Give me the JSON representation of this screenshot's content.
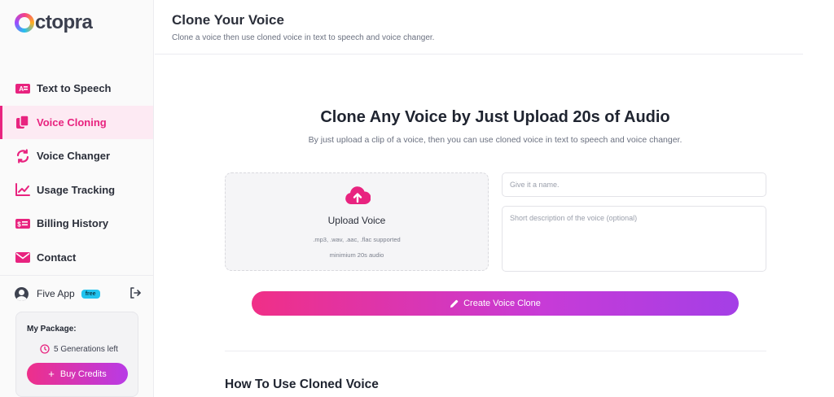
{
  "app": {
    "logo_text": "ctopra"
  },
  "sidebar": {
    "items": [
      {
        "label": "Text to Speech",
        "icon": "text-to-speech-icon",
        "active": false
      },
      {
        "label": "Voice Cloning",
        "icon": "copy-icon",
        "active": true
      },
      {
        "label": "Voice Changer",
        "icon": "refresh-icon",
        "active": false
      },
      {
        "label": "Usage Tracking",
        "icon": "chart-line-icon",
        "active": false
      },
      {
        "label": "Billing History",
        "icon": "billing-icon",
        "active": false
      },
      {
        "label": "Contact",
        "icon": "envelope-icon",
        "active": false
      }
    ],
    "user": {
      "name": "Five App",
      "plan_badge": "free"
    },
    "package": {
      "title": "My Package:",
      "generations_left": "5 Generations left",
      "buy_label": "Buy Credits"
    }
  },
  "header": {
    "title": "Clone Your Voice",
    "subtitle": "Clone a voice then use cloned voice in text to speech and voice changer."
  },
  "main": {
    "hero_title": "Clone Any Voice by Just Upload 20s of Audio",
    "hero_subtitle": "By just upload a clip of a voice, then you can use cloned voice in text to speech and voice changer.",
    "upload": {
      "label": "Upload Voice",
      "formats": ".mp3, .wav, .aac, .flac supported",
      "minimum": "minimium 20s audio"
    },
    "name_input": {
      "placeholder": "Give it a name.",
      "value": ""
    },
    "description_input": {
      "placeholder": "Short description of the voice (optional)",
      "value": ""
    },
    "create_button": "Create Voice Clone",
    "howto_title": "How To Use Cloned Voice"
  },
  "colors": {
    "accent": "#e8237f",
    "gradient_start": "#f02f87",
    "gradient_end": "#a43fe6",
    "badge": "#22c4ef"
  }
}
